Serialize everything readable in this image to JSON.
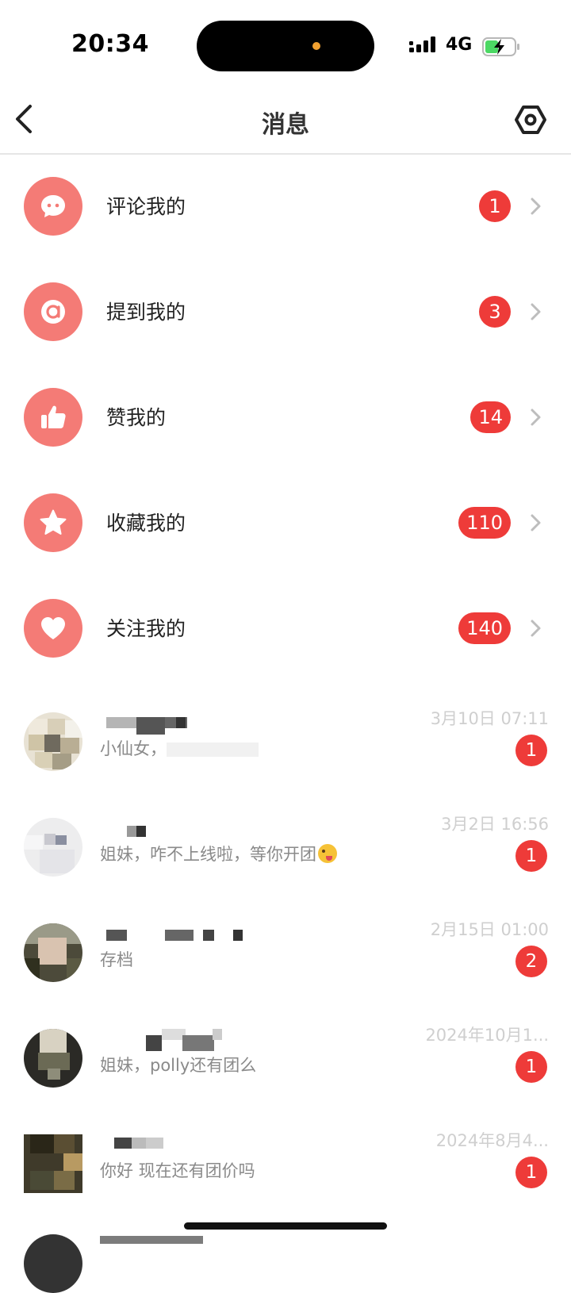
{
  "status_bar": {
    "time": "20:34",
    "network": "4G"
  },
  "nav": {
    "title": "消息",
    "back_icon": "chevron-left-icon",
    "settings_icon": "hexagon-settings-icon"
  },
  "categories": [
    {
      "label": "评论我的",
      "badge": "1",
      "icon": "comment-icon"
    },
    {
      "label": "提到我的",
      "badge": "3",
      "icon": "at-icon"
    },
    {
      "label": "赞我的",
      "badge": "14",
      "icon": "thumbs-up-icon"
    },
    {
      "label": "收藏我的",
      "badge": "110",
      "icon": "star-icon"
    },
    {
      "label": "关注我的",
      "badge": "140",
      "icon": "heart-icon"
    }
  ],
  "conversations": [
    {
      "time": "3月10日 07:11",
      "message": "小仙女，",
      "badge": "1"
    },
    {
      "time": "3月2日 16:56",
      "message": "姐妹，咋不上线啦，等你开团",
      "badge": "1"
    },
    {
      "time": "2月15日 01:00",
      "message": "存档",
      "badge": "2"
    },
    {
      "time": "2024年10月1...",
      "message": "姐妹，polly还有团么",
      "badge": "1"
    },
    {
      "time": "2024年8月4...",
      "message": "你好 现在还有团价吗",
      "badge": "1"
    }
  ],
  "colors": {
    "accent_icon": "#f47b76",
    "badge_red": "#ee3b39",
    "meta_gray": "#cfcfcf"
  }
}
